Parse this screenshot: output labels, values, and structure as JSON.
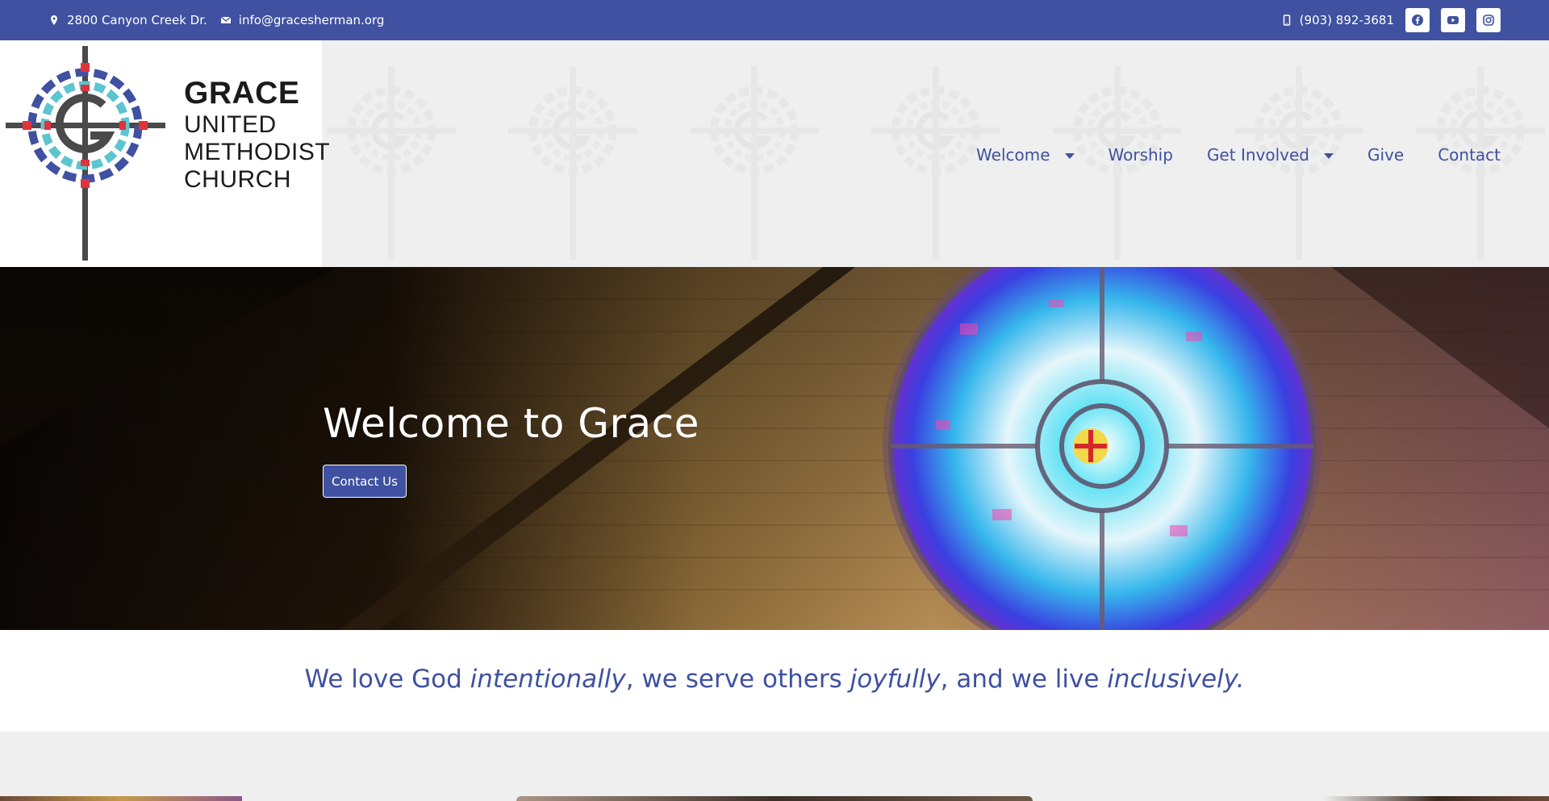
{
  "topbar": {
    "address": "2800 Canyon Creek Dr.",
    "email": "info@gracesherman.org",
    "phone": "(903) 892-3681",
    "social": [
      "facebook-icon",
      "youtube-icon",
      "instagram-icon"
    ]
  },
  "logo": {
    "name": "GRACE",
    "line1": "UNITED",
    "line2": "METHODIST",
    "line3": "CHURCH"
  },
  "nav": {
    "items": [
      {
        "label": "Welcome",
        "dropdown": true
      },
      {
        "label": "Worship",
        "dropdown": false
      },
      {
        "label": "Get Involved",
        "dropdown": true
      },
      {
        "label": "Give",
        "dropdown": false
      },
      {
        "label": "Contact",
        "dropdown": false
      }
    ]
  },
  "hero": {
    "title": "Welcome to Grace",
    "button": "Contact Us"
  },
  "mission": {
    "part1": "We love God ",
    "em1": "intentionally",
    "part2": ", we serve others ",
    "em2": "joyfully",
    "part3": ", and we live ",
    "em3": "inclusively."
  },
  "colors": {
    "brand": "#3f51a0",
    "header_bg": "#efefef",
    "logo_red": "#e0343c",
    "logo_teal": "#5cc5cf",
    "logo_gray": "#4a4a4a"
  }
}
